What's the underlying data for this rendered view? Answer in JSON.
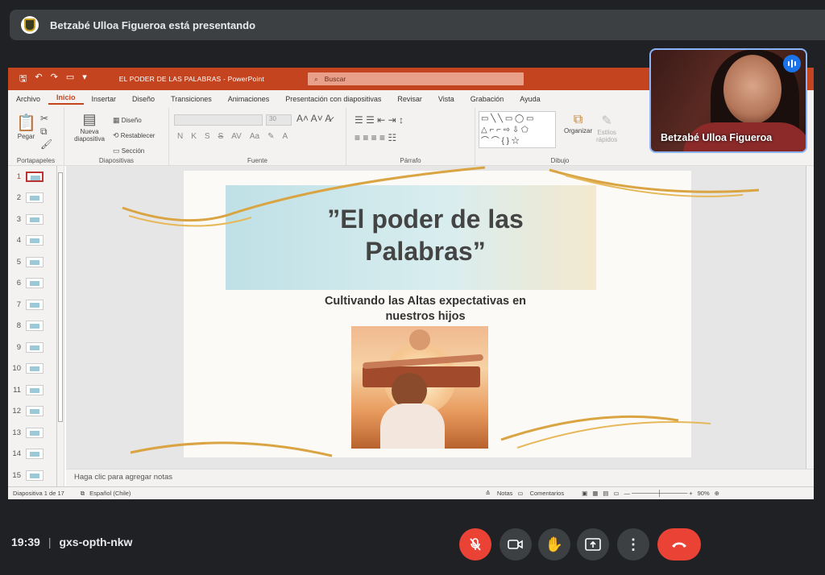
{
  "meet": {
    "presenting_text": "Betzabé Ulloa Figueroa está presentando",
    "time": "19:39",
    "separator": "|",
    "meeting_code": "gxs-opth-nkw",
    "participant_name": "Betzabé Ulloa Figueroa",
    "controls": [
      "mic-off-icon",
      "camera-icon",
      "raise-hand-icon",
      "present-icon",
      "more-icon",
      "end-call-icon"
    ],
    "colors": {
      "end_call": "#ea4335",
      "speaking": "#1a73e8",
      "bar": "#3c4043"
    }
  },
  "powerpoint": {
    "document_title": "EL PODER DE LAS PALABRAS  -  PowerPoint",
    "search_placeholder": "Buscar",
    "menu": [
      "Archivo",
      "Inicio",
      "Insertar",
      "Diseño",
      "Transiciones",
      "Animaciones",
      "Presentación con diapositivas",
      "Revisar",
      "Vista",
      "Grabación",
      "Ayuda"
    ],
    "active_menu": "Inicio",
    "ribbon": {
      "clipboard": {
        "paste": "Pegar",
        "label": "Portapapeles"
      },
      "slides": {
        "new_slide_1": "Nueva",
        "new_slide_2": "diapositiva",
        "design": "Diseño",
        "reset": "Restablecer",
        "section": "Sección",
        "label": "Diapositivas"
      },
      "font": {
        "size": "30",
        "bold": "N",
        "italic": "K",
        "underline": "S",
        "strike": "S",
        "label": "Fuente"
      },
      "paragraph": {
        "label": "Párrafo"
      },
      "drawing": {
        "organize": "Organizar",
        "quick_styles_1": "Estilos",
        "quick_styles_2": "rápidos",
        "label": "Dibujo"
      }
    },
    "slide_numbers": [
      "1",
      "2",
      "3",
      "4",
      "5",
      "6",
      "7",
      "8",
      "9",
      "10",
      "11",
      "12",
      "13",
      "14",
      "15"
    ],
    "selected_slide": "1",
    "slide": {
      "title_line1": "”El poder de las",
      "title_line2": "Palabras”",
      "subtitle_line1": "Cultivando las Altas expectativas en",
      "subtitle_line2": "nuestros hijos"
    },
    "notes_placeholder": "Haga clic para agregar notas",
    "status": {
      "slide_info": "Diapositiva 1 de 17",
      "language": "Español (Chile)",
      "notes": "Notas",
      "comments": "Comentarios",
      "zoom": "90%"
    },
    "accent": "#c4441f"
  }
}
